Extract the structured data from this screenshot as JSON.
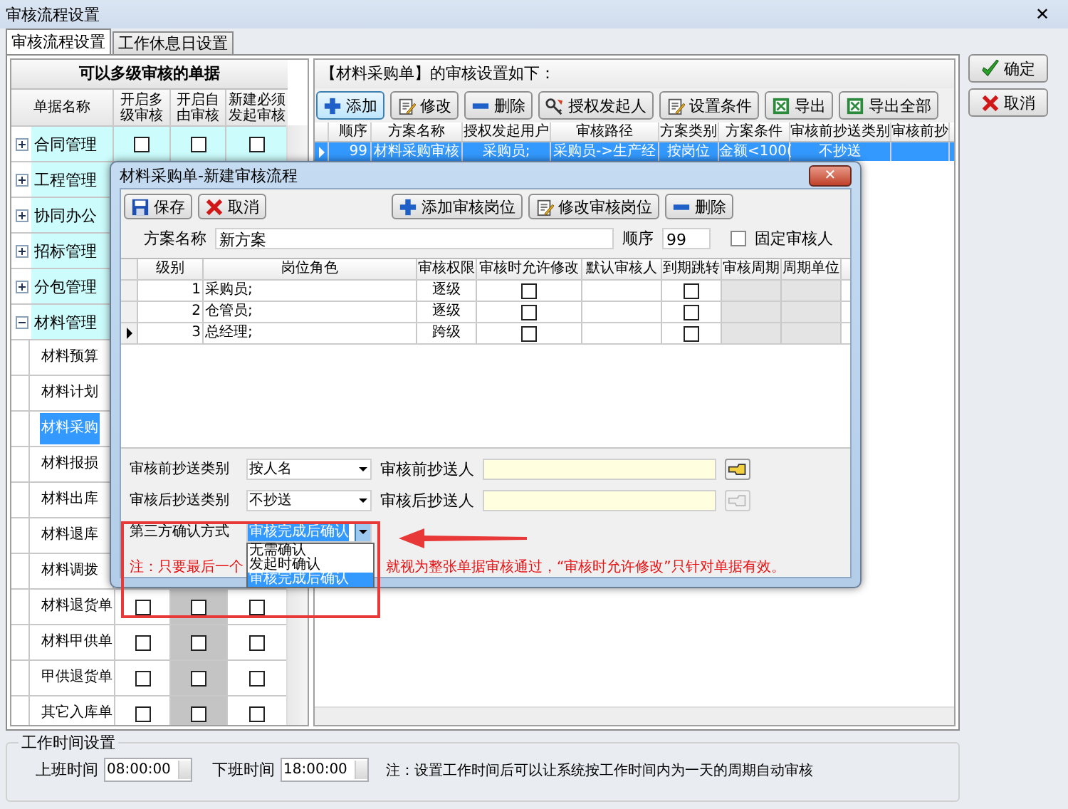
{
  "window": {
    "title": "审核流程设置",
    "close": "✕"
  },
  "tabs": [
    {
      "label": "审核流程设置",
      "selected": true
    },
    {
      "label": "工作休息日设置",
      "selected": false
    }
  ],
  "doc_panel": {
    "title": "可以多级审核的单据",
    "columns": [
      "单据名称",
      "开启多级审核",
      "开启自由审核",
      "新建必须发起审核"
    ],
    "rows": [
      {
        "name": "合同管理",
        "expanded": false,
        "checks": [
          false,
          false,
          false
        ]
      },
      {
        "name": "工程管理",
        "expanded": false
      },
      {
        "name": "协同办公",
        "expanded": false
      },
      {
        "name": "招标管理",
        "expanded": false
      },
      {
        "name": "分包管理",
        "expanded": false
      },
      {
        "name": "材料管理",
        "expanded": true,
        "children": [
          {
            "name": "材料预算",
            "selected": false
          },
          {
            "name": "材料计划",
            "selected": false
          },
          {
            "name": "材料采购",
            "selected": true
          },
          {
            "name": "材料报损",
            "selected": false
          },
          {
            "name": "材料出库",
            "selected": false
          },
          {
            "name": "材料退库",
            "selected": false
          },
          {
            "name": "材料调拨",
            "selected": false
          },
          {
            "name": "材料退货单",
            "selected": false,
            "checks": [
              false,
              false,
              false
            ]
          },
          {
            "name": "材料甲供单",
            "selected": false,
            "checks": [
              false,
              false,
              false
            ]
          },
          {
            "name": "甲供退货单",
            "selected": false,
            "checks": [
              false,
              false,
              false
            ]
          },
          {
            "name": "其它入库单",
            "selected": false,
            "checks": [
              false,
              false,
              false
            ]
          }
        ]
      }
    ]
  },
  "plan_panel": {
    "caption": "【材料采购单】的审核设置如下：",
    "toolbar": [
      {
        "label": "添加",
        "kind": "plus"
      },
      {
        "label": "修改",
        "kind": "edit"
      },
      {
        "label": "删除",
        "kind": "minus"
      },
      {
        "label": "授权发起人",
        "kind": "key"
      },
      {
        "label": "设置条件",
        "kind": "edit"
      },
      {
        "label": "导出",
        "kind": "excel"
      },
      {
        "label": "导出全部",
        "kind": "excel"
      }
    ],
    "columns": [
      "顺序",
      "方案名称",
      "授权发起用户",
      "审核路径",
      "方案类别",
      "方案条件",
      "审核前抄送类别",
      "审核前抄"
    ],
    "rows": [
      {
        "selected": true,
        "cells": [
          "99",
          "材料采购审核",
          "采购员;",
          "采购员->生产经",
          "按岗位",
          "金额<100(",
          "不抄送"
        ]
      }
    ]
  },
  "side_buttons": [
    {
      "label": "确定",
      "kind": "check"
    },
    {
      "label": "取消",
      "kind": "cross"
    }
  ],
  "work_time": {
    "title": "工作时间设置",
    "start_label": "上班时间",
    "start": "08:00:00",
    "end_label": "下班时间",
    "end": "18:00:00",
    "note": "注：设置工作时间后可以让系统按工作时间内为一天的周期自动审核"
  },
  "dialog": {
    "title": "材料采购单-新建审核流程",
    "left_buttons": [
      {
        "label": "保存",
        "kind": "save"
      },
      {
        "label": "取消",
        "kind": "cross"
      }
    ],
    "right_buttons": [
      {
        "label": "添加审核岗位",
        "kind": "plus"
      },
      {
        "label": "修改审核岗位",
        "kind": "edit"
      },
      {
        "label": "删除",
        "kind": "minus"
      }
    ],
    "name_label": "方案名称",
    "name_value": "新方案",
    "order_label": "顺序",
    "order_value": "99",
    "fixed": {
      "label": "固定审核人",
      "checked": false
    },
    "grid": {
      "columns": [
        "级别",
        "岗位角色",
        "审核权限",
        "审核时允许修改",
        "默认审核人",
        "到期跳转",
        "审核周期",
        "周期单位"
      ],
      "rows": [
        {
          "level": "1",
          "role": "采购员;",
          "permission": "逐级",
          "allow_edit": false,
          "jump": false,
          "current": false
        },
        {
          "level": "2",
          "role": "仓管员;",
          "permission": "逐级",
          "allow_edit": false,
          "jump": false,
          "current": false
        },
        {
          "level": "3",
          "role": "总经理;",
          "permission": "跨级",
          "allow_edit": false,
          "jump": false,
          "current": true
        }
      ]
    },
    "cc_fields": [
      {
        "label": "审核前抄送类别",
        "value": "按人名",
        "person_label": "审核前抄送人",
        "picker_disabled": false
      },
      {
        "label": "审核后抄送类别",
        "value": "不抄送",
        "person_label": "审核后抄送人",
        "picker_disabled": true
      }
    ],
    "confirm": {
      "label": "第三方确认方式",
      "value": "审核完成后确认",
      "options": [
        {
          "label": "无需确认",
          "selected": false
        },
        {
          "label": "发起时确认",
          "selected": false
        },
        {
          "label": "审核完成后确认",
          "selected": true
        }
      ]
    },
    "note_start": "注：只要最后一个",
    "note_end": "就视为整张单据审核通过，“审核时允许修改”只针对单据有效。"
  }
}
